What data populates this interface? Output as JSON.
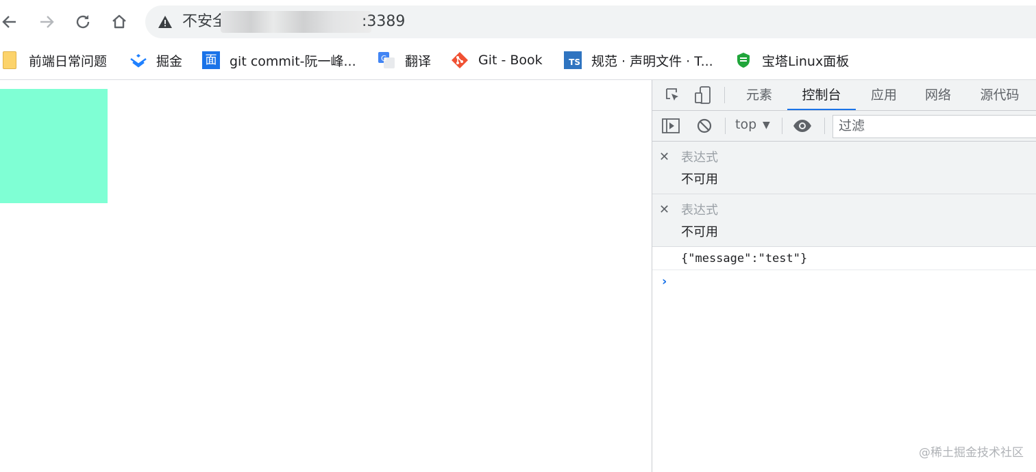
{
  "browser": {
    "security_label": "不安全",
    "url_port": ":3389",
    "icons": {
      "back": "arrow-left-icon",
      "forward": "arrow-right-icon",
      "reload": "reload-icon",
      "home": "home-icon",
      "warning": "warning-icon"
    }
  },
  "bookmarks": [
    {
      "label": "前端日常问题",
      "icon": "folder-icon"
    },
    {
      "label": "掘金",
      "icon": "juejin-icon"
    },
    {
      "label": "git commit-阮一峰...",
      "icon": "mian-icon",
      "icon_text": "面"
    },
    {
      "label": "翻译",
      "icon": "translate-icon"
    },
    {
      "label": "Git - Book",
      "icon": "git-icon"
    },
    {
      "label": "规范 · 声明文件 · T...",
      "icon": "ts-icon",
      "icon_text": "TS"
    },
    {
      "label": "宝塔Linux面板",
      "icon": "bt-icon"
    }
  ],
  "page": {
    "box_color": "#7fffd4"
  },
  "devtools": {
    "tabs": [
      {
        "label": "元素",
        "active": false
      },
      {
        "label": "控制台",
        "active": true
      },
      {
        "label": "应用",
        "active": false
      },
      {
        "label": "网络",
        "active": false
      },
      {
        "label": "源代码",
        "active": false
      }
    ],
    "console_context": "top",
    "filter_placeholder": "过滤",
    "watch_expressions": [
      {
        "expression": "表达式",
        "value": "不可用"
      },
      {
        "expression": "表达式",
        "value": "不可用"
      }
    ],
    "log": "{\"message\":\"test\"}",
    "accent_color": "#1a73e8"
  },
  "watermark": "@稀土掘金技术社区"
}
